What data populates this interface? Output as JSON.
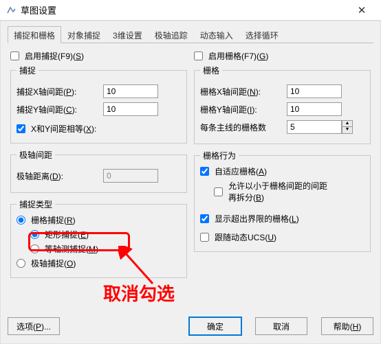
{
  "window": {
    "title": "草图设置"
  },
  "tabs": [
    "捕捉和栅格",
    "对象捕捉",
    "3维设置",
    "极轴追踪",
    "动态输入",
    "选择循环"
  ],
  "left": {
    "enableSnap": "启用捕捉(F9)(",
    "enableSnapU": "S",
    "snapGroup": "捕捉",
    "snapX_a": "捕捉X轴间距(",
    "snapX_u": "P",
    "snapX_b": "):",
    "snapXVal": "10",
    "snapY_a": "捕捉Y轴间距(",
    "snapY_u": "C",
    "snapY_b": "):",
    "snapYVal": "10",
    "equal_a": "X和Y间距相等(",
    "equal_u": "X",
    "equal_b": "):",
    "polarGroup": "极轴间距",
    "polarDist_a": "极轴距离(",
    "polarDist_u": "D",
    "polarDist_b": "):",
    "polarDistVal": "0",
    "typeGroup": "捕捉类型",
    "gridSnap_a": "栅格捕捉(",
    "gridSnap_u": "R",
    "rectSnap_a": "矩形捕捉(",
    "rectSnap_u": "E",
    "isoSnap_a": "等轴测捕捉(",
    "isoSnap_u": "M",
    "polarSnap_a": "极轴捕捉(",
    "polarSnap_u": "O",
    "close": ")"
  },
  "right": {
    "enableGrid_a": "启用栅格(F7)(",
    "enableGrid_u": "G",
    "gridGroup": "栅格",
    "gridX_a": "栅格X轴间距(",
    "gridX_u": "N",
    "gridX_b": "):",
    "gridXVal": "10",
    "gridY_a": "栅格Y轴间距(",
    "gridY_u": "I",
    "gridY_b": "):",
    "gridYVal": "10",
    "gridMajor": "每条主线的栅格数",
    "gridMajorVal": "5",
    "behaviorGroup": "栅格行为",
    "adaptive_a": "自适应栅格(",
    "adaptive_u": "A",
    "subdiv_a": "允许以小于栅格间距的间距再拆分(",
    "subdiv_u": "B",
    "beyond_a": "显示超出界限的栅格(",
    "beyond_u": "L",
    "dynUCS_a": "跟随动态UCS(",
    "dynUCS_u": "U"
  },
  "buttons": {
    "options_a": "选项(",
    "options_u": "P",
    "options_b": ")...",
    "ok": "确定",
    "cancel": "取消",
    "help_a": "帮助(",
    "help_u": "H",
    "help_b": ")"
  },
  "annotation": "取消勾选"
}
